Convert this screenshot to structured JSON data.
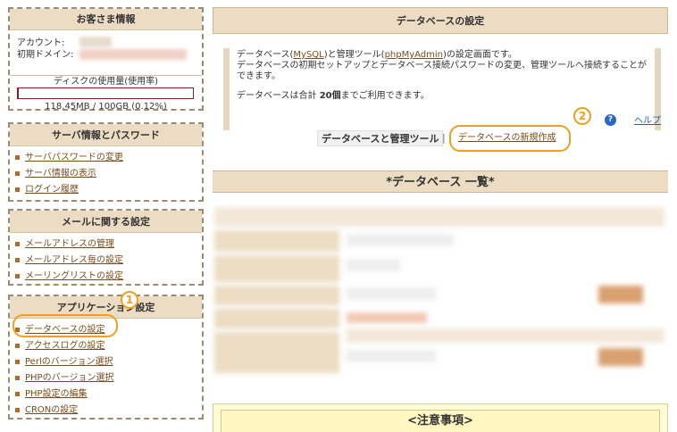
{
  "sidebar": {
    "customer_info": {
      "title": "お客さま情報",
      "account_label": "アカウント:",
      "domain_label": "初期ドメイン:",
      "disk_title": "ディスクの使用量(使用率)",
      "disk_usage": "118.45MB / 100GB (0.12%)",
      "disk_usage_fraction": 0.0012,
      "disk_bar_color": "#8b1a1a"
    },
    "server": {
      "title": "サーバ情報とパスワード",
      "items": [
        "サーバパスワードの変更",
        "サーバ情報の表示",
        "ログイン履歴"
      ]
    },
    "mail": {
      "title": "メールに関する設定",
      "items": [
        "メールアドレスの管理",
        "メールアドレス毎の設定",
        "メーリングリストの設定"
      ]
    },
    "app": {
      "title": "アプリケーション設定",
      "items": [
        "データベースの設定",
        "アクセスログの設定",
        "Perlのバージョン選択",
        "PHPのバージョン選択",
        "PHP設定の編集",
        "CRONの設定"
      ]
    }
  },
  "main": {
    "title": "データベースの設定",
    "intro": {
      "part1": "データベース(",
      "mysql": "MySQL",
      "part2": ")と管理ツール(",
      "phpmyadmin": "phpMyAdmin",
      "part3": ")の設定画面です。",
      "line2": "データベースの初期セットアップとデータベース接続パスワードの変更、管理ツールへ接続することができます。",
      "limit_prefix": "データベースは合計 ",
      "limit_count": "20個",
      "limit_suffix": "までご利用できます。"
    },
    "help_label": "ヘルプ",
    "tabs": {
      "manage": "データベースと管理ツール",
      "separator": "|",
      "new": "データベースの新規作成"
    },
    "list_title": "*データベース 一覧*",
    "notice_title": "<注意事項>",
    "annotations": [
      "1",
      "2"
    ]
  },
  "colors": {
    "accent_orange": "#f0a020",
    "header_bg": "#ecdcc3",
    "link": "#7a4b1a"
  }
}
